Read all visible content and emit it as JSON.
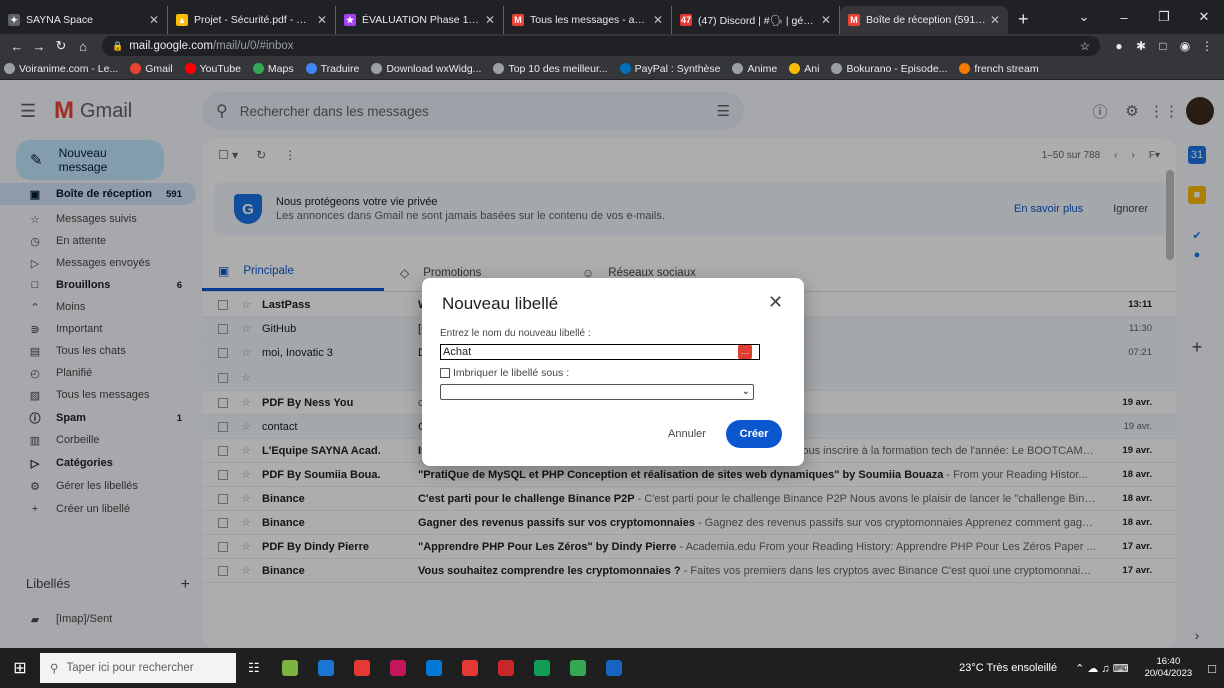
{
  "browser": {
    "tabs": [
      {
        "title": "SAYNA Space",
        "color": "#5f6368",
        "glyph": "✦"
      },
      {
        "title": "Projet - Sécurité.pdf - Google",
        "color": "#fbbc04",
        "glyph": "▲"
      },
      {
        "title": "ÉVALUATION Phase 1 - DISCO",
        "color": "#a142f4",
        "glyph": "★"
      },
      {
        "title": "Tous les messages - achim.m",
        "color": "#ea4335",
        "glyph": "M"
      },
      {
        "title": "(47) Discord | #🗣 | général |",
        "color": "#e53935",
        "glyph": "47"
      },
      {
        "title": "Boîte de réception (591) - ach",
        "color": "#ea4335",
        "glyph": "M"
      }
    ],
    "new_tab": "+",
    "url_host": "mail.google.com",
    "url_path": "/mail/u/0/#inbox",
    "bookmarks": [
      {
        "label": "Voiranime.com - Le...",
        "color": "#9aa0a6"
      },
      {
        "label": "Gmail",
        "color": "#ea4335"
      },
      {
        "label": "YouTube",
        "color": "#ff0000"
      },
      {
        "label": "Maps",
        "color": "#34a853"
      },
      {
        "label": "Traduire",
        "color": "#4285f4"
      },
      {
        "label": "Download wxWidg...",
        "color": "#9aa0a6"
      },
      {
        "label": "Top 10 des meilleur...",
        "color": "#9aa0a6"
      },
      {
        "label": "PayPal : Synthèse",
        "color": "#0070ba"
      },
      {
        "label": "Anime",
        "color": "#9aa0a6"
      },
      {
        "label": "Ani",
        "color": "#fbbc04"
      },
      {
        "label": "Bokurano - Episode...",
        "color": "#9aa0a6"
      },
      {
        "label": "french stream",
        "color": "#f57c00"
      }
    ]
  },
  "gmail": {
    "logo_text": "Gmail",
    "search_placeholder": "Rechercher dans les messages",
    "compose": "Nouveau message",
    "nav": [
      {
        "icon": "inbox-icon",
        "glyph": "▣",
        "label": "Boîte de réception",
        "count": "591",
        "active": true,
        "bold": true
      },
      {
        "icon": "star-icon",
        "glyph": "☆",
        "label": "Messages suivis",
        "count": ""
      },
      {
        "icon": "clock-icon",
        "glyph": "◷",
        "label": "En attente",
        "count": ""
      },
      {
        "icon": "send-icon",
        "glyph": "▷",
        "label": "Messages envoyés",
        "count": ""
      },
      {
        "icon": "draft-icon",
        "glyph": "□",
        "label": "Brouillons",
        "count": "6",
        "bold": true
      },
      {
        "icon": "chevron-up-icon",
        "glyph": "⌃",
        "label": "Moins",
        "count": ""
      },
      {
        "icon": "important-icon",
        "glyph": "⋑",
        "label": "Important",
        "count": ""
      },
      {
        "icon": "chat-icon",
        "glyph": "▤",
        "label": "Tous les chats",
        "count": ""
      },
      {
        "icon": "schedule-icon",
        "glyph": "◴",
        "label": "Planifié",
        "count": ""
      },
      {
        "icon": "all-mail-icon",
        "glyph": "▨",
        "label": "Tous les messages",
        "count": ""
      },
      {
        "icon": "spam-icon",
        "glyph": "ⓘ",
        "label": "Spam",
        "count": "1",
        "bold": true
      },
      {
        "icon": "trash-icon",
        "glyph": "▥",
        "label": "Corbeille",
        "count": ""
      },
      {
        "icon": "categories-icon",
        "glyph": "▷",
        "label": "Catégories",
        "count": "",
        "bold": true
      },
      {
        "icon": "gear-icon",
        "glyph": "⚙",
        "label": "Gérer les libellés",
        "count": ""
      },
      {
        "icon": "plus-icon",
        "glyph": "+",
        "label": "Créer un libellé",
        "count": ""
      }
    ],
    "labels_title": "Libellés",
    "labels": [
      {
        "label": "[Imap]/Sent"
      }
    ],
    "pager": "1–50 sur 788",
    "privacy": {
      "title": "Nous protégeons votre vie privée",
      "subtitle": "Les annonces dans Gmail ne sont jamais basées sur le contenu de vos e-mails.",
      "learn": "En savoir plus",
      "ignore": "Ignorer"
    },
    "tabs": [
      {
        "label": "Principale",
        "active": true,
        "glyph": "▣"
      },
      {
        "label": "Promotions",
        "glyph": "◇"
      },
      {
        "label": "Réseaux sociaux",
        "glyph": "☺"
      }
    ],
    "emails": [
      {
        "sender": "LastPass",
        "subject": "We",
        "snippet": "stPass Welcome to LastPass Your digital life just got easi...",
        "date": "13:11",
        "unread": true
      },
      {
        "sender": "GitHub",
        "subject": "[G",
        "snippet": "eTrash! A third-party OAuth application (Discord) with re...",
        "date": "11:30",
        "unread": false
      },
      {
        "sender": "moi, Inovatic 3",
        "subject": "De",
        "snippet": "r au mail indiqué ci-dessus 1 mois avant le stage. Cordia...",
        "date": "07:21",
        "unread": false
      },
      {
        "sender": "",
        "subject": "",
        "snippet": "",
        "date": "",
        "unread": false
      },
      {
        "sender": "PDF By Ness You",
        "subject": "",
        "snippet": "ou - Academia.edu From your Reading History: Le livre d...",
        "date": "19 avr.",
        "unread": true
      },
      {
        "sender": "contact",
        "subject": "Ca",
        "snippet": "avons bien reçu votre e-mail et vous en remercions. No...",
        "date": "19 avr.",
        "unread": false
      },
      {
        "sender": "L'Equipe SAYNA Acad.",
        "subject": "Inscrivez-vous au BOOTCAMP SAYNA 🔥",
        "snippet": " - PLUS QUE 2 SEMAINES pour vous inscrire à la formation tech de l'année: Le BOOTCAMP SA...",
        "date": "19 avr.",
        "unread": true
      },
      {
        "sender": "PDF By Soumiia Boua.",
        "subject": "\"PratiQue de MySQL et PHP Conception et réalisation de sites web dynamiques\" by Soumiia Bouaza",
        "snippet": " - From your Reading Histor...",
        "date": "18 avr.",
        "unread": true
      },
      {
        "sender": "Binance",
        "subject": "C'est parti pour le challenge Binance P2P",
        "snippet": " - C'est parti pour le challenge Binance P2P Nous avons le plaisir de lancer le \"challenge Bina...",
        "date": "18 avr.",
        "unread": true
      },
      {
        "sender": "Binance",
        "subject": "Gagner des revenus passifs sur vos cryptomonnaies",
        "snippet": " - Gagnez des revenus passifs sur vos cryptomonnaies Apprenez comment gagne...",
        "date": "18 avr.",
        "unread": true
      },
      {
        "sender": "PDF By Dindy Pierre",
        "subject": "\"Apprendre PHP Pour Les Zéros\" by Dindy Pierre",
        "snippet": " - Academia.edu From your Reading History: Apprendre PHP Pour Les Zéros Paper ...",
        "date": "17 avr.",
        "unread": true
      },
      {
        "sender": "Binance",
        "subject": "Vous souhaitez comprendre les cryptomonnaies ?",
        "snippet": " - Faites vos premiers dans les cryptos avec Binance C'est quoi une cryptomonnaie ?...",
        "date": "17 avr.",
        "unread": true
      }
    ]
  },
  "dialog": {
    "title": "Nouveau libellé",
    "prompt": "Entrez le nom du nouveau libellé :",
    "input_value": "Achat",
    "nest_label": "Imbriquer le libellé sous :",
    "cancel": "Annuler",
    "create": "Créer"
  },
  "taskbar": {
    "search_placeholder": "Taper ici pour rechercher",
    "weather": "23°C Très ensoleillé",
    "time": "16:40",
    "date": "20/04/2023",
    "apps": [
      "#7cb342",
      "#1976d2",
      "#e53935",
      "#c2185b",
      "#0078d7",
      "#e53935",
      "#c62828",
      "#0f9d58",
      "#34a853",
      "#1565c0"
    ]
  }
}
